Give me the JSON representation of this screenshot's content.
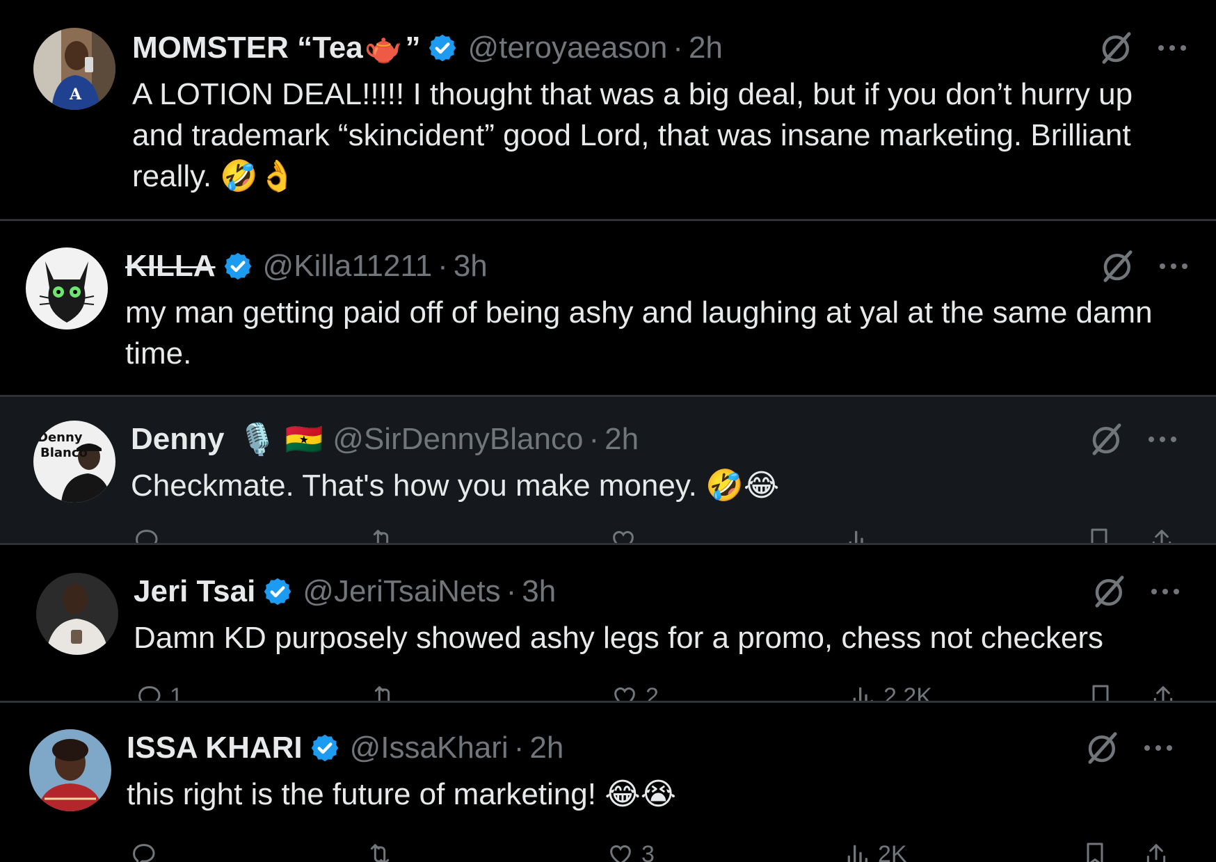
{
  "tweets": [
    {
      "name": "MOMSTER “Tea",
      "name_suffix": "”",
      "name_glyph": "🫖",
      "verified": true,
      "handle": "@teroyaeason",
      "time": "2h",
      "text": "A LOTION DEAL!!!!! I thought that was a big deal, but if you don’t hurry up and trademark “skincident” good Lord, that was insane marketing. Brilliant really. 🤣👌"
    },
    {
      "name": "KILLA",
      "verified": true,
      "handle": "@Killa11211",
      "time": "3h",
      "text": "my man getting paid off of being ashy and laughing at yal at the same damn time."
    },
    {
      "name": "Denny",
      "name_glyphs": "🎙️ 🇬🇭",
      "verified": false,
      "handle": "@SirDennyBlanco",
      "time": "2h",
      "avatar_text_1": "Denny",
      "avatar_text_2": "Blanco",
      "text": "Checkmate. That's how you make money. 🤣😂"
    },
    {
      "name": "Jeri Tsai",
      "verified": true,
      "handle": "@JeriTsaiNets",
      "time": "3h",
      "text": "Damn KD purposely showed ashy legs for a promo, chess not checkers",
      "replies": "1",
      "likes": "2",
      "views": "2.2K"
    },
    {
      "name": "ISSA KHARI",
      "verified": true,
      "handle": "@IssaKhari",
      "time": "2h",
      "text": "this right is the future of marketing! 😂😭",
      "likes": "3",
      "views": "2K"
    }
  ],
  "separator": "·",
  "colors": {
    "background": "#000000",
    "dim_background": "#15181c",
    "text": "#e7e9ea",
    "muted": "#71767b",
    "verified": "#1d9bf0",
    "divider": "#2f3336"
  },
  "icons": [
    "verified-badge-icon",
    "grok-icon",
    "more-icon",
    "reply-icon",
    "retweet-icon",
    "like-icon",
    "views-icon",
    "bookmark-icon",
    "share-icon"
  ]
}
